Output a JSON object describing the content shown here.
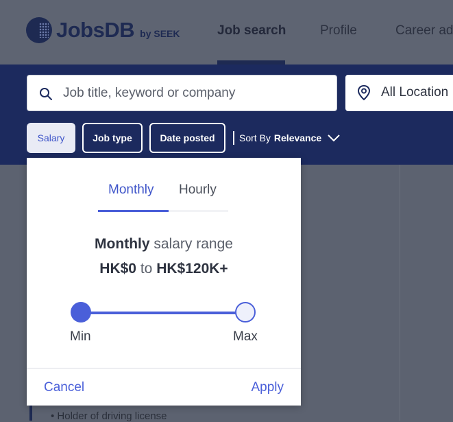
{
  "header": {
    "logo_text": "JobsDB",
    "logo_sub": "by SEEK",
    "nav": [
      "Job search",
      "Profile",
      "Career ad"
    ]
  },
  "search": {
    "keyword_placeholder": "Job title, keyword or company",
    "location_value": "All Location"
  },
  "filters": {
    "chips": [
      "Salary",
      "Job type",
      "Date posted"
    ],
    "sort_prefix": "Sort By",
    "sort_value": "Relevance"
  },
  "salary_popup": {
    "tabs": [
      "Monthly",
      "Hourly"
    ],
    "active_tab": "Monthly",
    "title_bold": "Monthly",
    "title_rest": "salary range",
    "min_value": "HK$0",
    "to_text": "to",
    "max_value": "HK$120K+",
    "slider_min_label": "Min",
    "slider_max_label": "Max",
    "cancel_label": "Cancel",
    "apply_label": "Apply"
  },
  "background_content": {
    "bullet_text": "Holder of driving license"
  },
  "colors": {
    "brand_navy": "#1c2a5e",
    "accent_blue": "#4a5fd9"
  }
}
